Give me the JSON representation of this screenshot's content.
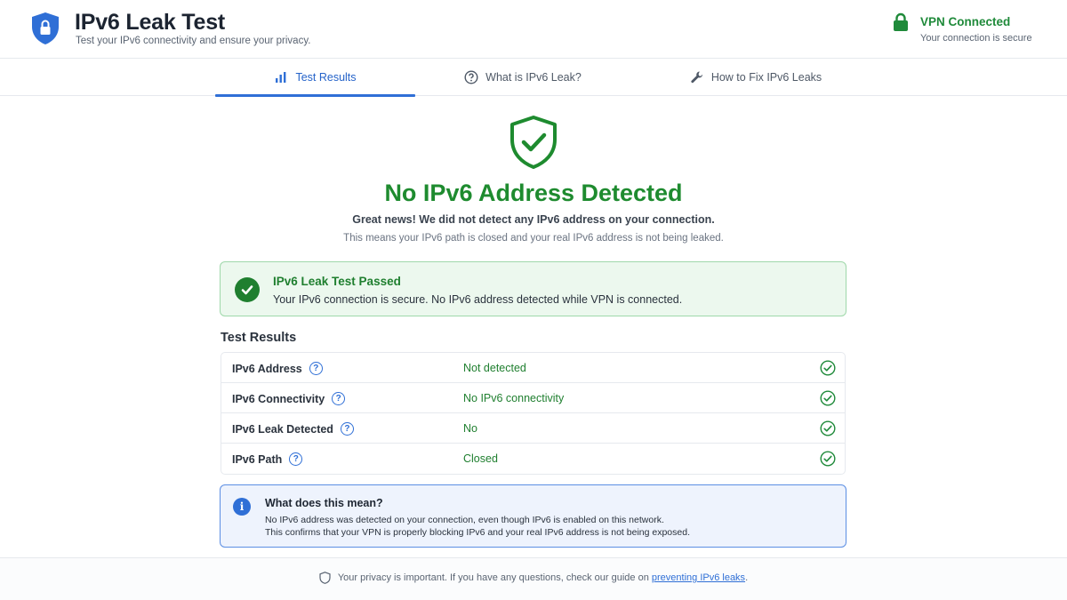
{
  "header": {
    "title": "IPv6 Leak Test",
    "subtitle": "Test your IPv6 connectivity and ensure your privacy.",
    "vpn_status": "VPN Connected",
    "vpn_substatus": "Your connection is secure"
  },
  "tabs": [
    {
      "label": "Test Results",
      "icon": "bar-chart-icon",
      "active": true
    },
    {
      "label": "What is IPv6 Leak?",
      "icon": "question-circle-icon",
      "active": false
    },
    {
      "label": "How to Fix IPv6 Leaks",
      "icon": "wrench-icon",
      "active": false
    }
  ],
  "hero": {
    "title": "No IPv6 Address Detected",
    "line1": "Great news! We did not detect any IPv6 address on your connection.",
    "line2": "This means your IPv6 path is closed and your real IPv6 address is not being leaked."
  },
  "pass_banner": {
    "title": "IPv6 Leak Test Passed",
    "text": "Your IPv6 connection is secure. No IPv6 address detected while VPN is connected."
  },
  "results": {
    "heading": "Test Results",
    "rows": [
      {
        "label": "IPv6 Address",
        "value": "Not detected"
      },
      {
        "label": "IPv6 Connectivity",
        "value": "No IPv6 connectivity"
      },
      {
        "label": "IPv6 Leak Detected",
        "value": "No"
      },
      {
        "label": "IPv6 Path",
        "value": "Closed"
      }
    ]
  },
  "info": {
    "title": "What does this mean?",
    "line1": "No IPv6 address was detected on your connection, even though IPv6 is enabled on this network.",
    "line2": "This confirms that your VPN is properly blocking IPv6 and your real IPv6 address is not being exposed."
  },
  "footer": {
    "text": "Your privacy is important. If you have any questions, check our guide on",
    "link": "preventing IPv6 leaks",
    "suffix": "."
  },
  "colors": {
    "brand_blue": "#2f6fd6",
    "success_green": "#1f8a3a",
    "pass_bg": "#ecf8ee",
    "info_bg": "#eef3fd"
  }
}
